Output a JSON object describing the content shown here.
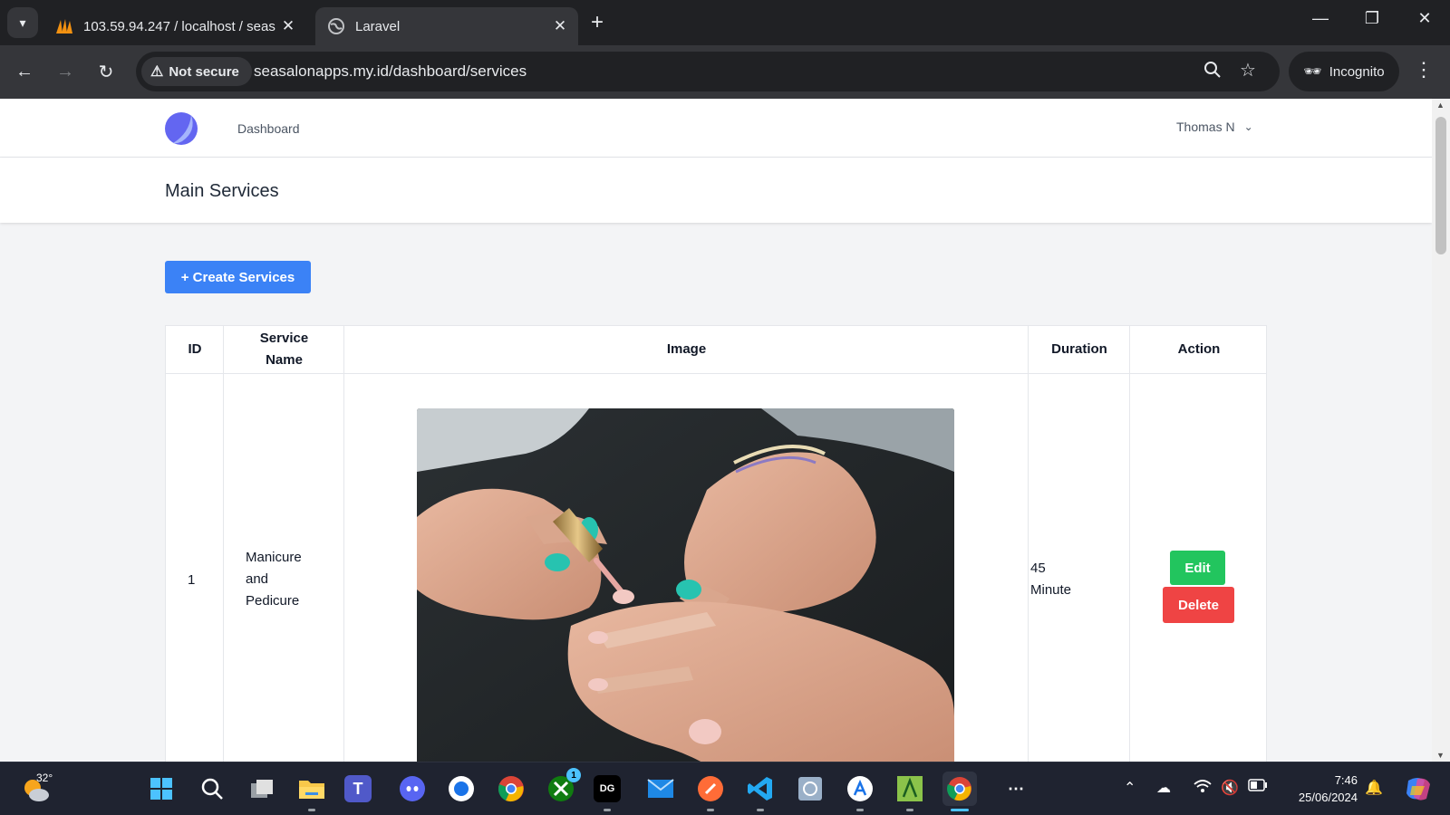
{
  "browser": {
    "tabs": [
      {
        "title": "103.59.94.247 / localhost / seas",
        "active": false
      },
      {
        "title": "Laravel",
        "active": true
      }
    ],
    "new_tab": "+",
    "security_label": "Not secure",
    "url": "seasalonapps.my.id/dashboard/services",
    "profile_label": "Incognito"
  },
  "app": {
    "nav_link": "Dashboard",
    "user_name": "Thomas N",
    "page_title": "Main Services",
    "create_button": "+ Create Services"
  },
  "table": {
    "headers": [
      "ID",
      "Service Name",
      "Image",
      "Duration",
      "Action"
    ],
    "rows": [
      {
        "id": "1",
        "service_name": "Manicure and Pedicure",
        "image": "manicure-photo",
        "duration": "45 Minute",
        "edit_label": "Edit",
        "delete_label": "Delete"
      }
    ]
  },
  "taskbar": {
    "weather_temp": "32°",
    "time": "7:46",
    "date": "25/06/2024",
    "badge_count": "1"
  },
  "colors": {
    "primary_button": "#3b82f6",
    "edit_button": "#22c55e",
    "delete_button": "#ef4444",
    "browser_frame": "#202124",
    "toolbar": "#35363a"
  }
}
